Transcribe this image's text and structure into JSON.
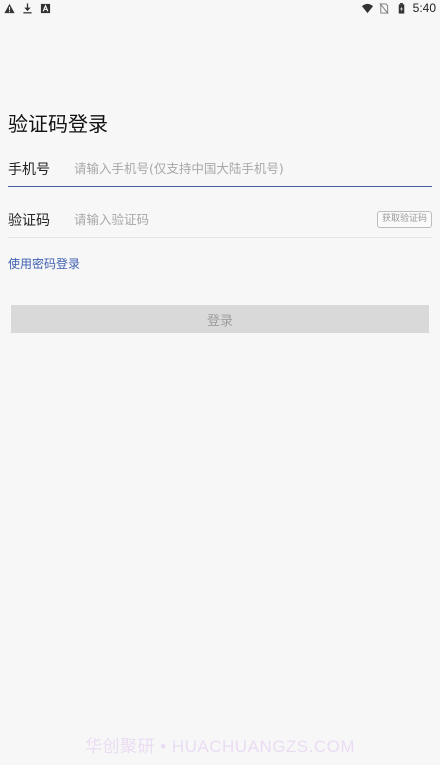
{
  "status_bar": {
    "time": "5:40",
    "left_icons": [
      "warning-icon",
      "download-icon",
      "app-notification-icon"
    ],
    "right_icons": [
      "wifi-icon",
      "no-sim-icon",
      "battery-icon"
    ]
  },
  "login": {
    "title": "验证码登录",
    "phone_label": "手机号",
    "phone_placeholder": "请输入手机号(仅支持中国大陆手机号)",
    "phone_value": "",
    "code_label": "验证码",
    "code_placeholder": "请输入验证码",
    "code_value": "",
    "get_code_label": "获取验证码",
    "switch_mode_label": "使用密码登录",
    "submit_label": "登录"
  },
  "watermark": {
    "text": "华创聚研 • HUACHUANGZS.COM"
  },
  "colors": {
    "background": "#f7f7f7",
    "accent": "#3e5fb0",
    "active_underline": "#4a5ea8",
    "button_disabled_bg": "#d9d9d9",
    "button_disabled_text": "#9e9e9e",
    "placeholder": "#a8a8a8"
  }
}
